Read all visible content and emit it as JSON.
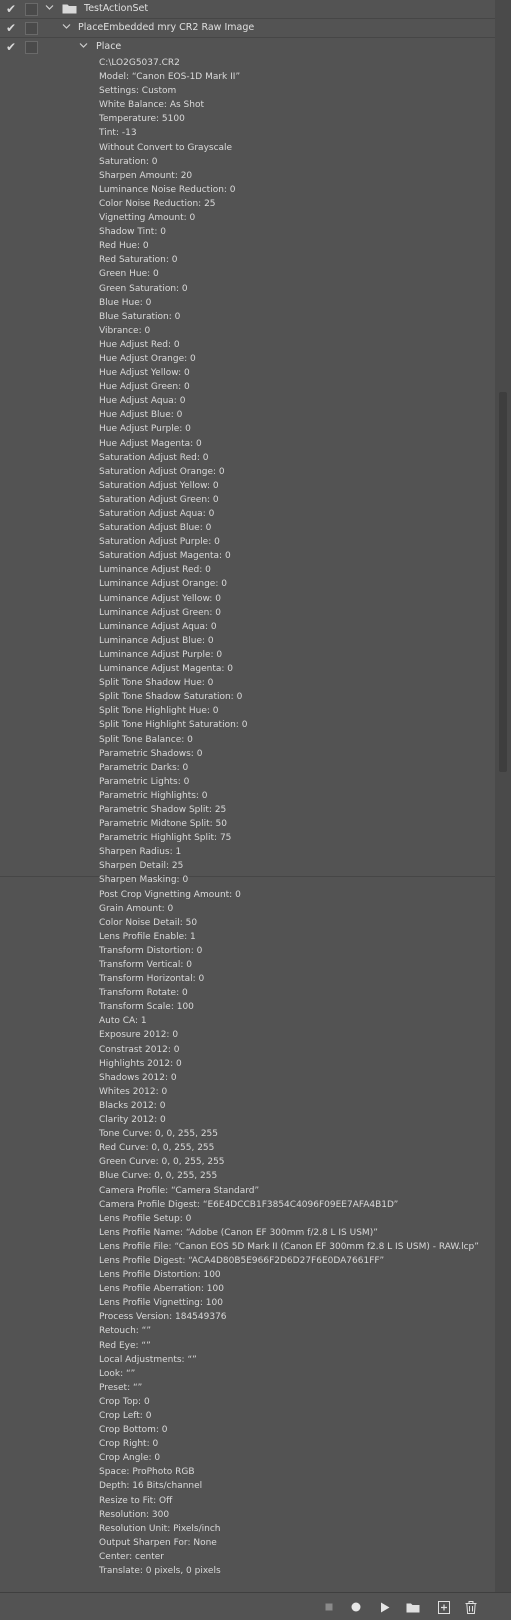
{
  "tree": {
    "action_set_label": "TestActionSet",
    "action_label": "PlaceEmbedded mry CR2 Raw Image",
    "step_label": "Place"
  },
  "params": [
    "C:\\LO2G5037.CR2",
    "Model:  “Canon EOS-1D Mark II”",
    "Settings: Custom",
    "White Balance: As Shot",
    "Temperature: 5100",
    "Tint: -13",
    "Without Convert to Grayscale",
    "Saturation: 0",
    "Sharpen Amount: 20",
    "Luminance Noise Reduction: 0",
    "Color Noise Reduction: 25",
    "Vignetting Amount: 0",
    "Shadow Tint: 0",
    "Red Hue: 0",
    "Red Saturation: 0",
    "Green Hue: 0",
    "Green Saturation: 0",
    "Blue Hue: 0",
    "Blue Saturation: 0",
    "Vibrance: 0",
    "Hue Adjust Red: 0",
    "Hue Adjust Orange: 0",
    "Hue Adjust Yellow: 0",
    "Hue Adjust Green: 0",
    "Hue Adjust Aqua: 0",
    "Hue Adjust Blue: 0",
    "Hue Adjust Purple: 0",
    "Hue Adjust Magenta: 0",
    "Saturation Adjust Red: 0",
    "Saturation Adjust Orange: 0",
    "Saturation Adjust Yellow: 0",
    "Saturation Adjust Green: 0",
    "Saturation Adjust Aqua: 0",
    "Saturation Adjust Blue: 0",
    "Saturation Adjust Purple: 0",
    "Saturation Adjust Magenta: 0",
    "Luminance Adjust Red: 0",
    "Luminance Adjust Orange: 0",
    "Luminance Adjust Yellow: 0",
    "Luminance Adjust Green: 0",
    "Luminance Adjust Aqua: 0",
    "Luminance Adjust Blue: 0",
    "Luminance Adjust Purple: 0",
    "Luminance Adjust Magenta: 0",
    "Split Tone Shadow Hue: 0",
    "Split Tone Shadow Saturation: 0",
    "Split Tone Highlight Hue: 0",
    "Split Tone Highlight Saturation: 0",
    "Split Tone Balance: 0",
    "Parametric Shadows: 0",
    "Parametric Darks: 0",
    "Parametric Lights: 0",
    "Parametric Highlights: 0",
    "Parametric Shadow Split: 25",
    "Parametric Midtone Split: 50",
    "Parametric Highlight Split: 75",
    "Sharpen Radius: 1",
    "Sharpen Detail: 25",
    "Sharpen Masking: 0",
    "Post Crop Vignetting Amount: 0",
    "Grain Amount: 0",
    "Color Noise Detail: 50",
    "Lens Profile Enable: 1",
    "Transform Distortion: 0",
    "Transform Vertical: 0",
    "Transform Horizontal: 0",
    "Transform Rotate: 0",
    "Transform Scale: 100",
    "Auto CA: 1",
    "Exposure 2012: 0",
    "Constrast 2012: 0",
    "Highlights 2012: 0",
    "Shadows 2012: 0",
    "Whites 2012: 0",
    "Blacks 2012: 0",
    "Clarity 2012: 0",
    "Tone Curve: 0, 0, 255, 255",
    "Red Curve: 0, 0, 255, 255",
    "Green Curve: 0, 0, 255, 255",
    "Blue Curve: 0, 0, 255, 255",
    "Camera Profile:  “Camera Standard”",
    "Camera Profile Digest:   “E6E4DCCB1F3854C4096F09EE7AFA4B1D”",
    "Lens Profile Setup: 0",
    "Lens Profile Name:  “Adobe (Canon EF 300mm f/2.8 L IS USM)”",
    "Lens Profile File:  “Canon EOS 5D Mark II (Canon EF 300mm f2.8 L IS USM) - RAW.lcp”",
    "Lens Profile Digest:  “ACA4D80B5E966F2D6D27F6E0DA7661FF”",
    "Lens Profile Distortion: 100",
    "Lens Profile Aberration: 100",
    "Lens Profile Vignetting: 100",
    "Process Version: 184549376",
    "Retouch:  “”",
    "Red Eye:  “”",
    "Local Adjustments:  “”",
    "Look:  “”",
    "Preset:  “”",
    "Crop Top: 0",
    "Crop Left: 0",
    "Crop Bottom: 0",
    "Crop Right: 0",
    "Crop Angle: 0",
    "Space: ProPhoto RGB",
    "Depth: 16 Bits/channel",
    "Resize to Fit: Off",
    "Resolution: 300",
    "Resolution Unit: Pixels/inch",
    "Output Sharpen For: None",
    "Center: center",
    "Translate: 0 pixels, 0 pixels"
  ],
  "icons": {
    "checkmark": "check-icon",
    "expand": "chevron-down-icon",
    "folder": "folder-icon",
    "stop": "stop-icon",
    "record": "record-icon",
    "play": "play-icon",
    "new_set": "new-set-icon",
    "new_action": "new-action-icon",
    "delete": "trash-icon"
  }
}
